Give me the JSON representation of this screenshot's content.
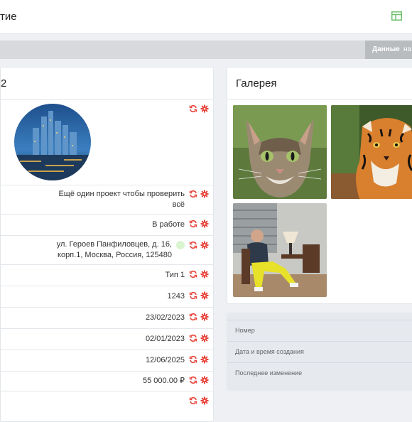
{
  "header": {
    "title": "тие",
    "layout_icon": "layout-icon",
    "accent": "#5cb85c"
  },
  "tabs": {
    "data_label": "Данные",
    "next_label": "на"
  },
  "left_panel": {
    "title": "2",
    "fields": [
      {
        "value": "Ещё один проект чтобы проверить всё"
      },
      {
        "value": "В работе"
      },
      {
        "value": "ул. Героев Панфиловцев, д. 16, корп.1, Москва, Россия, 125480"
      },
      {
        "value": "Тип 1"
      },
      {
        "value": "1243"
      },
      {
        "value": "23/02/2023"
      },
      {
        "value": "02/01/2023"
      },
      {
        "value": "12/06/2025"
      },
      {
        "value": "55 000.00 ₽"
      },
      {
        "value": ""
      }
    ],
    "action_icons": [
      "refresh-icon",
      "gear-icon"
    ],
    "action_color": "#e8453c"
  },
  "gallery": {
    "title": "Галерея",
    "photos": [
      "cat-photo",
      "tiger-photo",
      "person-photo"
    ]
  },
  "meta": {
    "number_label": "Номер",
    "created_label": "Дата и время создания",
    "modified_label": "Последнее изменение"
  }
}
